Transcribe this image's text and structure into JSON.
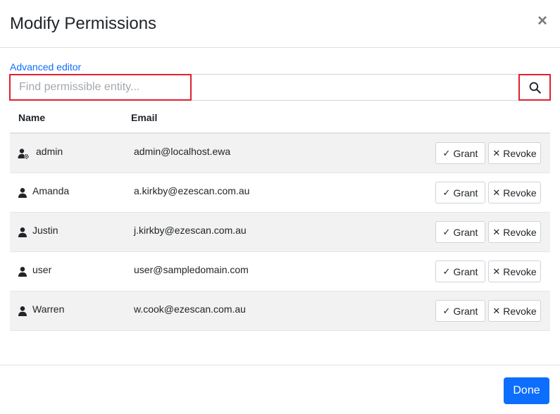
{
  "dialog": {
    "title": "Modify Permissions",
    "close_glyph": "×"
  },
  "advanced_editor": {
    "label": "Advanced editor"
  },
  "search": {
    "placeholder": "Find permissible entity...",
    "value": "",
    "button_icon": "search-icon"
  },
  "table": {
    "columns": [
      "Name",
      "Email"
    ],
    "rows": [
      {
        "name": "admin",
        "email": "admin@localhost.ewa",
        "icon": "user-gear-icon",
        "grant_label": "Grant",
        "revoke_label": "Revoke"
      },
      {
        "name": "Amanda",
        "email": "a.kirkby@ezescan.com.au",
        "icon": "user-icon",
        "grant_label": "Grant",
        "revoke_label": "Revoke"
      },
      {
        "name": "Justin",
        "email": "j.kirkby@ezescan.com.au",
        "icon": "user-icon",
        "grant_label": "Grant",
        "revoke_label": "Revoke"
      },
      {
        "name": "user",
        "email": "user@sampledomain.com",
        "icon": "user-icon",
        "grant_label": "Grant",
        "revoke_label": "Revoke"
      },
      {
        "name": "Warren",
        "email": "w.cook@ezescan.com.au",
        "icon": "user-icon",
        "grant_label": "Grant",
        "revoke_label": "Revoke"
      }
    ]
  },
  "footer": {
    "done_label": "Done"
  },
  "colors": {
    "primary": "#0d6efd",
    "highlight_border": "#e0202e",
    "row_alt": "#f2f2f2"
  }
}
